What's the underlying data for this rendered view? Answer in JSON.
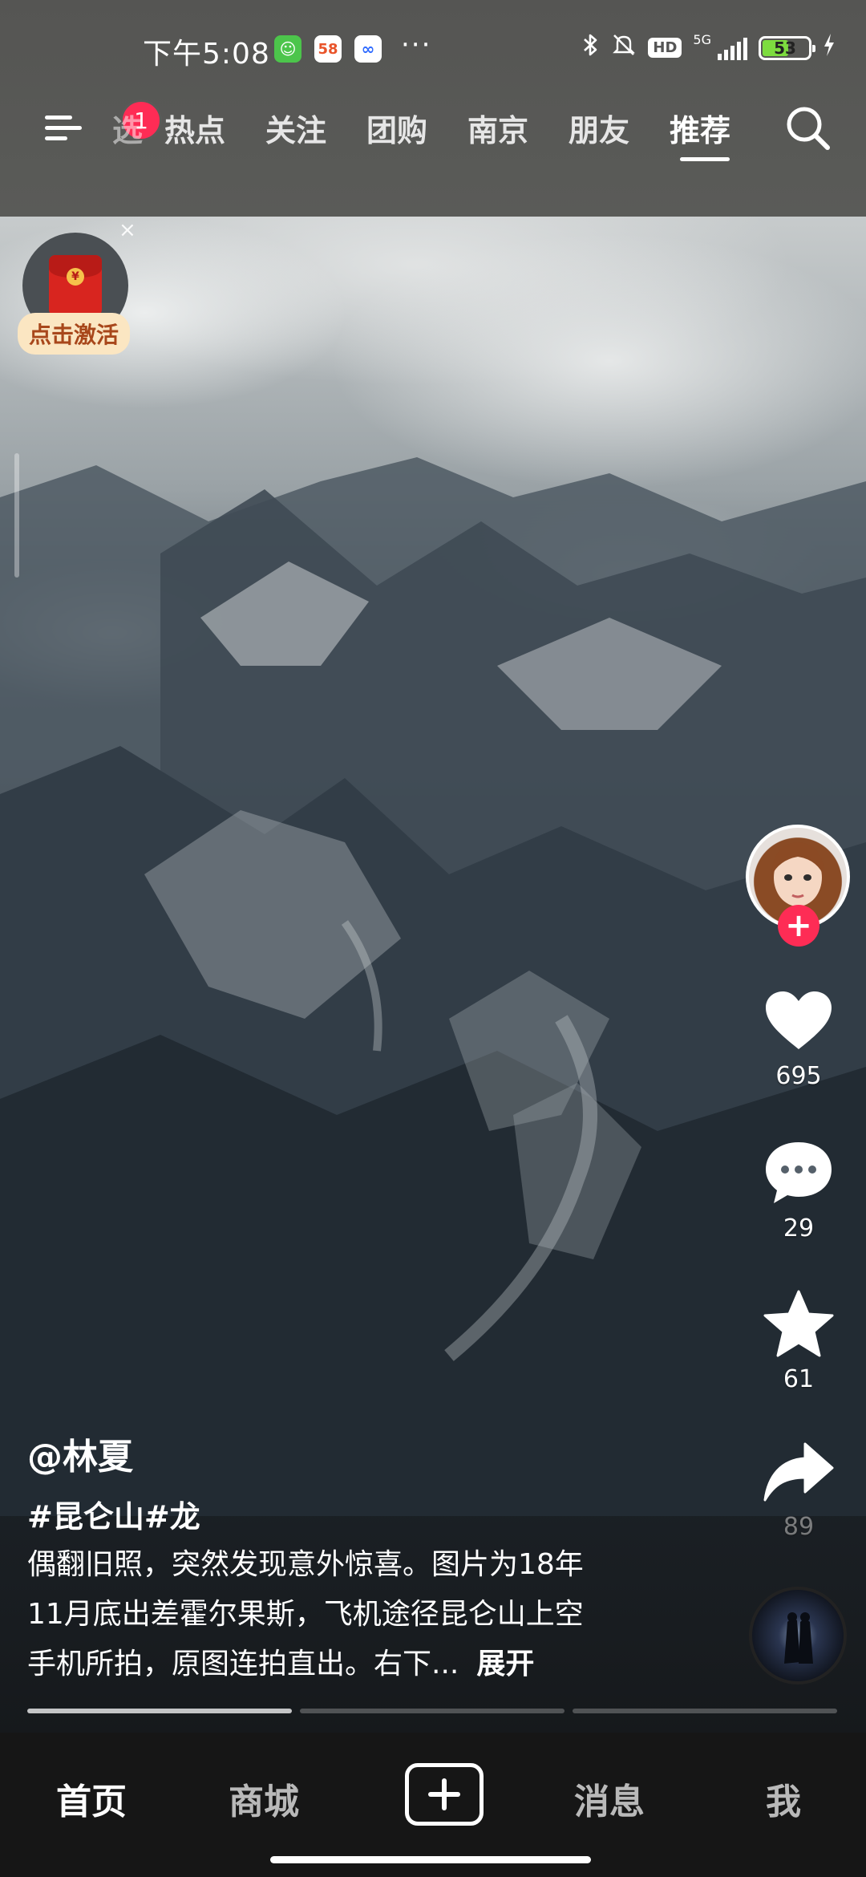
{
  "status_bar": {
    "time": "下午5:08",
    "network": "5G",
    "battery": "53",
    "more": "···"
  },
  "nav": {
    "badge_count": "1",
    "tabs": [
      {
        "label": "选"
      },
      {
        "label": "热点"
      },
      {
        "label": "关注"
      },
      {
        "label": "团购"
      },
      {
        "label": "南京"
      },
      {
        "label": "朋友"
      },
      {
        "label": "推荐"
      }
    ],
    "active_tab": "推荐"
  },
  "red_packet": {
    "label": "点击激活",
    "close": "×"
  },
  "actions": {
    "likes": "695",
    "comments": "29",
    "favorites": "61",
    "shares": "89"
  },
  "video": {
    "author": "@林夏",
    "hashtags": "#昆仑山#龙",
    "description_lines": [
      "偶翻旧照，突然发现意外惊喜。图片为18年",
      "11月底出差霍尔果斯，飞机途径昆仑山上空",
      "手机所拍，原图连拍直出。右下..."
    ],
    "expand_label": "展开",
    "segments": 3,
    "segments_viewed": 1
  },
  "bottom_nav": {
    "home": "首页",
    "mall": "商城",
    "messages": "消息",
    "me": "我"
  },
  "colors": {
    "accent": "#fe2c55",
    "top_bar": "#585856",
    "bottom_bar": "#161616"
  }
}
